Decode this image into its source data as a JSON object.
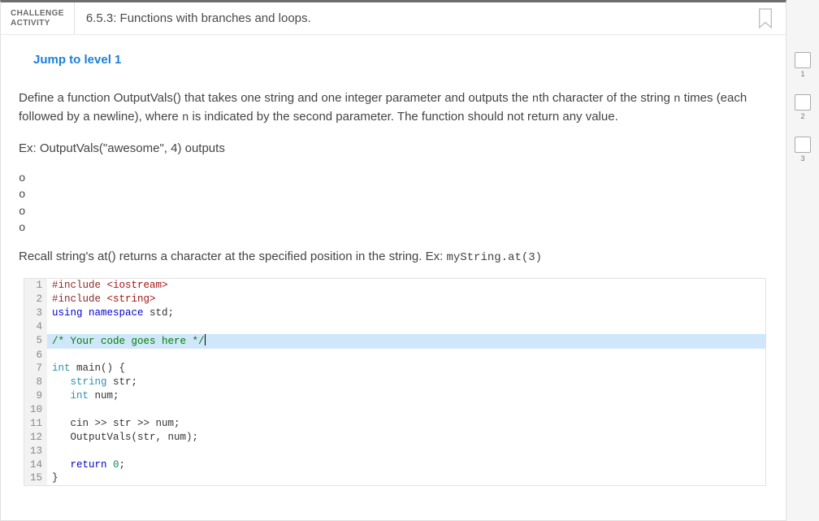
{
  "header": {
    "label_line1": "CHALLENGE",
    "label_line2": "ACTIVITY",
    "number": "6.5.3:",
    "title": "Functions with branches and loops."
  },
  "jump_link": "Jump to level 1",
  "description_html": "Define a function OutputVals() that takes one string and one integer parameter and outputs the nth character of the string n times (each followed by a newline), where n is indicated by the second parameter. The function should not return any value.",
  "example_intro": "Ex: OutputVals(\"awesome\", 4) outputs",
  "example_output": "o\no\no\no",
  "recall_text": "Recall string's at() returns a character at the specified position in the string. Ex: ",
  "recall_code": "myString.at(3)",
  "code": [
    {
      "n": 1,
      "parts": [
        [
          "pre",
          "#include "
        ],
        [
          "str",
          "<iostream>"
        ]
      ]
    },
    {
      "n": 2,
      "parts": [
        [
          "pre",
          "#include "
        ],
        [
          "str",
          "<string>"
        ]
      ]
    },
    {
      "n": 3,
      "parts": [
        [
          "kw",
          "using "
        ],
        [
          "kw",
          "namespace "
        ],
        [
          "id",
          "std"
        ],
        [
          "id",
          ";"
        ]
      ]
    },
    {
      "n": 4,
      "parts": []
    },
    {
      "n": 5,
      "hl": true,
      "parts": [
        [
          "cmt",
          "/* Your code goes here */"
        ]
      ],
      "caret": true
    },
    {
      "n": 6,
      "parts": []
    },
    {
      "n": 7,
      "parts": [
        [
          "type",
          "int "
        ],
        [
          "id",
          "main() {"
        ]
      ]
    },
    {
      "n": 8,
      "parts": [
        [
          "id",
          "   "
        ],
        [
          "type",
          "string "
        ],
        [
          "id",
          "str;"
        ]
      ]
    },
    {
      "n": 9,
      "parts": [
        [
          "id",
          "   "
        ],
        [
          "type",
          "int "
        ],
        [
          "id",
          "num;"
        ]
      ]
    },
    {
      "n": 10,
      "parts": []
    },
    {
      "n": 11,
      "parts": [
        [
          "id",
          "   cin >> str >> num;"
        ]
      ]
    },
    {
      "n": 12,
      "parts": [
        [
          "id",
          "   OutputVals(str, num);"
        ]
      ]
    },
    {
      "n": 13,
      "parts": []
    },
    {
      "n": 14,
      "parts": [
        [
          "id",
          "   "
        ],
        [
          "kw",
          "return "
        ],
        [
          "num",
          "0"
        ],
        [
          "id",
          ";"
        ]
      ]
    },
    {
      "n": 15,
      "parts": [
        [
          "id",
          "}"
        ]
      ]
    }
  ],
  "steps": [
    1,
    2,
    3
  ]
}
